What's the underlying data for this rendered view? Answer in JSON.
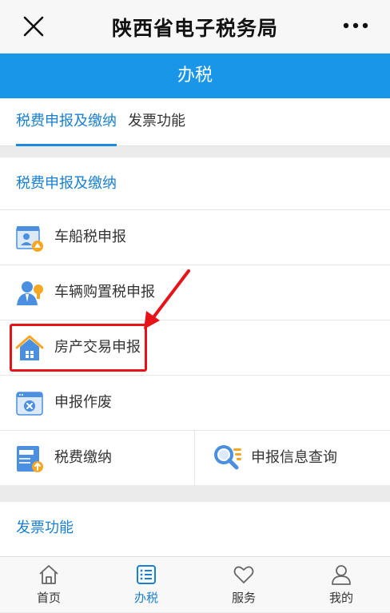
{
  "header": {
    "title": "陕西省电子税务局",
    "close_icon": "close-icon",
    "more_icon": "more-dots-icon"
  },
  "section_bar": {
    "title": "办税"
  },
  "tabs": [
    {
      "label": "税费申报及缴纳",
      "active": true
    },
    {
      "label": "发票功能",
      "active": false
    }
  ],
  "section1": {
    "title": "税费申报及缴纳",
    "items": [
      {
        "label": "车船税申报",
        "icon": "vessel-tax-icon"
      },
      {
        "label": "车辆购置税申报",
        "icon": "vehicle-purchase-tax-icon"
      },
      {
        "label": "房产交易申报",
        "icon": "house-icon"
      },
      {
        "label": "申报作废",
        "icon": "void-declaration-icon"
      }
    ],
    "split_items": [
      {
        "label": "税费缴纳",
        "icon": "tax-payment-icon"
      },
      {
        "label": "申报信息查询",
        "icon": "search-list-icon"
      }
    ]
  },
  "section2": {
    "title": "发票功能"
  },
  "bottom_nav": [
    {
      "label": "首页",
      "icon": "home-icon",
      "active": false
    },
    {
      "label": "办税",
      "icon": "list-icon",
      "active": true
    },
    {
      "label": "服务",
      "icon": "heart-icon",
      "active": false
    },
    {
      "label": "我的",
      "icon": "user-icon",
      "active": false
    }
  ],
  "colors": {
    "brand_blue": "#1a96e8",
    "link_blue": "#1a7fd0",
    "highlight_red": "#e6141a"
  }
}
